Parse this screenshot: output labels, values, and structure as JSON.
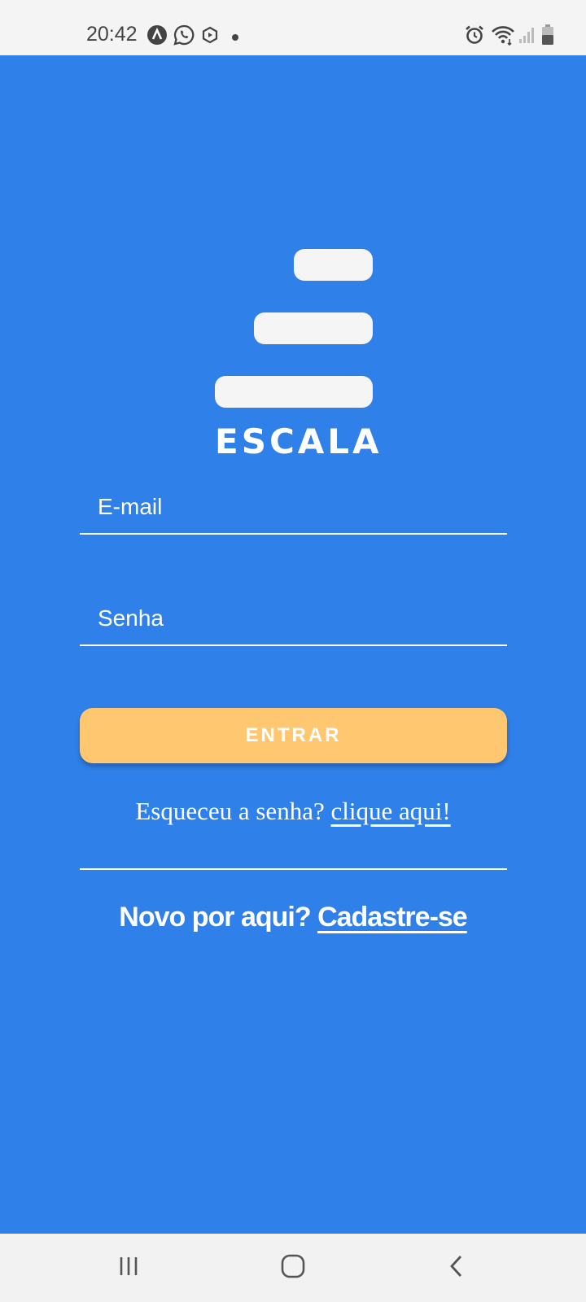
{
  "status_bar": {
    "time": "20:42",
    "left_icons": [
      "app-a-icon",
      "whatsapp-icon",
      "hexagon-play-icon",
      "notification-dot-icon"
    ],
    "right_icons": [
      "alarm-icon",
      "wifi-icon",
      "signal-icon",
      "battery-icon"
    ]
  },
  "logo": {
    "wordmark": "ESCALA"
  },
  "form": {
    "email_placeholder": "E-mail",
    "password_placeholder": "Senha",
    "submit_label": "ENTRAR"
  },
  "forgot": {
    "prompt": "Esqueceu a senha?",
    "link": "clique aqui!"
  },
  "signup": {
    "prompt": "Novo por aqui?",
    "link": "Cadastre-se"
  },
  "nav": {
    "buttons": [
      "recent-apps-icon",
      "home-icon",
      "back-icon"
    ]
  },
  "colors": {
    "background": "#3080ea",
    "button": "#ffc76f",
    "text": "#ffffff"
  }
}
